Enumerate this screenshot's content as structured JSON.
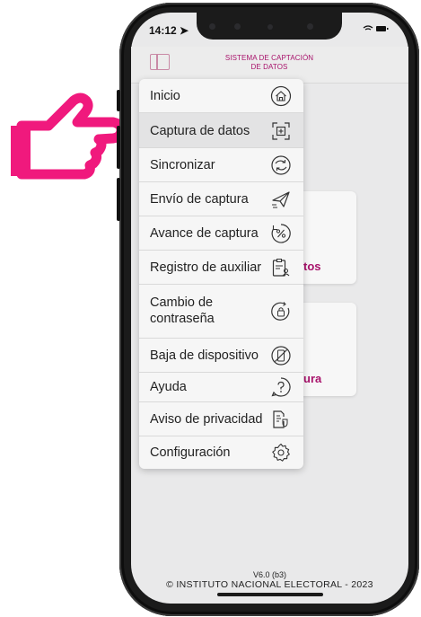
{
  "status_bar": {
    "time": "14:12",
    "indicators": "wifi-battery"
  },
  "header": {
    "title_line1": "SISTEMA DE CAPTACIÓN",
    "title_line2": "DE DATOS",
    "menu_toggle_icon": "sidebar-toggle-icon"
  },
  "background_cards": [
    {
      "text": "tos"
    },
    {
      "text": "ura"
    }
  ],
  "menu": {
    "items": [
      {
        "label": "Inicio",
        "icon": "home-icon"
      },
      {
        "label": "Captura de datos",
        "icon": "capture-icon",
        "selected": true
      },
      {
        "label": "Sincronizar",
        "icon": "sync-icon"
      },
      {
        "label": "Envío de captura",
        "icon": "send-icon"
      },
      {
        "label": "Avance de captura",
        "icon": "progress-icon"
      },
      {
        "label": "Registro de auxiliar",
        "icon": "register-icon"
      },
      {
        "label": "Cambio de",
        "label2": "contraseña",
        "icon": "password-icon"
      },
      {
        "label": "Baja de dispositivo",
        "icon": "device-off-icon"
      },
      {
        "label": "Ayuda",
        "icon": "help-icon"
      },
      {
        "label": "Aviso de privacidad",
        "icon": "privacy-icon"
      },
      {
        "label": "Configuración",
        "icon": "settings-icon"
      }
    ]
  },
  "footer": {
    "version": "V6.0 (b3)",
    "copyright": "© INSTITUTO NACIONAL ELECTORAL - 2023"
  },
  "colors": {
    "accent": "#a8126b",
    "hand": "#f0197d"
  }
}
